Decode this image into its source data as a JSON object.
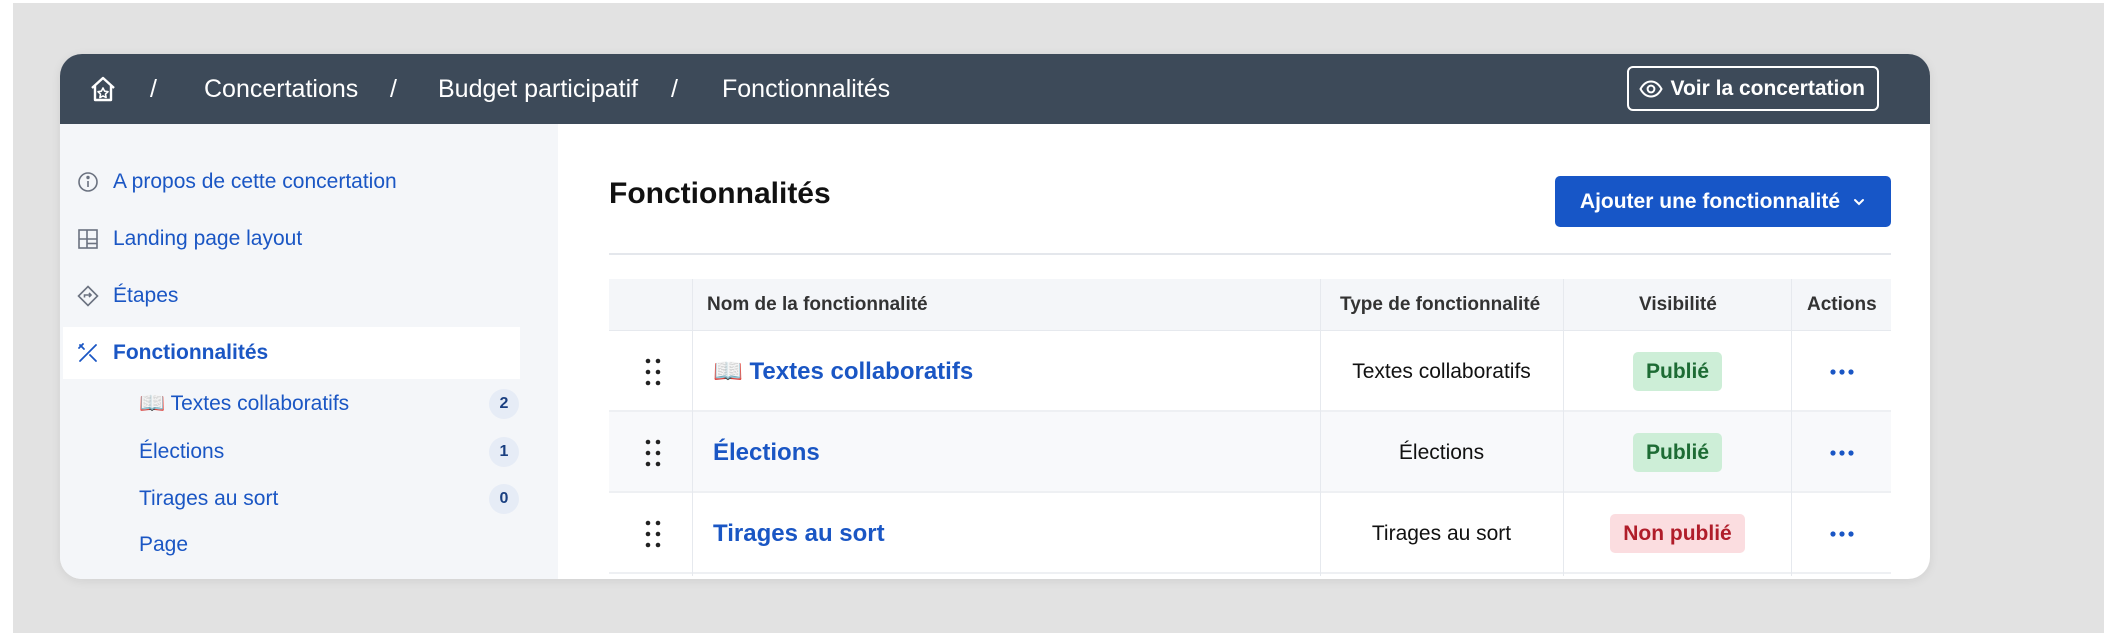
{
  "breadcrumb": {
    "items": [
      "Concertations",
      "Budget participatif",
      "Fonctionnalités"
    ],
    "separator": "/"
  },
  "header": {
    "view_button_label": "Voir la concertation"
  },
  "sidebar": {
    "items": [
      {
        "label": "A propos de cette concertation",
        "icon": "info-icon"
      },
      {
        "label": "Landing page layout",
        "icon": "layout-icon"
      },
      {
        "label": "Étapes",
        "icon": "steps-icon"
      },
      {
        "label": "Fonctionnalités",
        "icon": "tools-icon",
        "active": true
      }
    ],
    "sub_items": [
      {
        "label": "📖 Textes collaboratifs",
        "count": "2"
      },
      {
        "label": "Élections",
        "count": "1"
      },
      {
        "label": "Tirages au sort",
        "count": "0"
      },
      {
        "label": "Page"
      }
    ]
  },
  "main": {
    "title": "Fonctionnalités",
    "add_button_label": "Ajouter une fonctionnalité",
    "table": {
      "columns": [
        "Nom de la fonctionnalité",
        "Type de fonctionnalité",
        "Visibilité",
        "Actions"
      ],
      "rows": [
        {
          "name": "📖 Textes collaboratifs",
          "type": "Textes collaboratifs",
          "visibility": "Publié",
          "status": "published"
        },
        {
          "name": "Élections",
          "type": "Élections",
          "visibility": "Publié",
          "status": "published"
        },
        {
          "name": "Tirages au sort",
          "type": "Tirages au sort",
          "visibility": "Non publié",
          "status": "unpublished"
        }
      ]
    }
  },
  "colors": {
    "topbar": "#3d4a59",
    "accent": "#1756c7",
    "published_bg": "#cdeed7",
    "unpublished_bg": "#fbdde0"
  }
}
